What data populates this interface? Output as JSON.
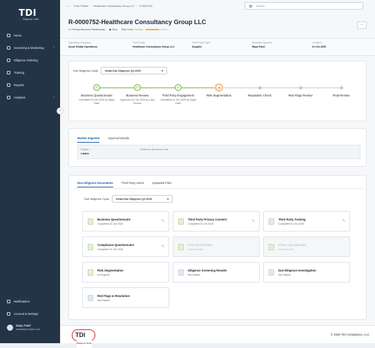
{
  "sidebar": {
    "logo": "TDI",
    "logo_sub": "Diligence Suite",
    "items": [
      {
        "label": "Home",
        "chev": ""
      },
      {
        "label": "Screening & Monitoring",
        "chev": "›"
      },
      {
        "label": "Diligence Ordering",
        "chev": ""
      },
      {
        "label": "Training",
        "chev": ""
      },
      {
        "label": "Reports",
        "chev": ""
      },
      {
        "label": "Analytics",
        "chev": "›"
      }
    ],
    "bottom": [
      {
        "label": "Notifications"
      },
      {
        "label": "Account & Settings"
      }
    ],
    "user_name": "Maya Patel",
    "user_email": "mpatel@example.com",
    "collapse": "‹"
  },
  "breadcrumb": {
    "home": "⌂",
    "sep": "/",
    "b1": "Third Parties",
    "b2": "Healthcare Consultancy Group LLC",
    "b3": "R-0000752"
  },
  "search": {
    "placeholder": "Search..."
  },
  "header": {
    "title": "R-0000752-Healthcare Consultancy Group LLC",
    "tag1": "Primary Business Relationship",
    "tag2": "New",
    "risk_label": "Risk Level:",
    "risk_value": "Medium",
    "risk_fraction": 0.6,
    "more": "···"
  },
  "info": {
    "c1_label": "Operating Company:",
    "c1_value": "Acme Global Operations",
    "c2_label": "Third Party:",
    "c2_value": "Healthcare Consultancy Group LLC",
    "c3_label": "Third Party Type:",
    "c3_value": "Supplier",
    "c4_label": "Business Sponsor:",
    "c4_value": "Maya Patel",
    "c5_label": "Created:",
    "c5_value": "01 Oct 2025"
  },
  "cycle": {
    "label": "Due Diligence Cycle",
    "value": "Initial Due Diligence Q4 2025"
  },
  "steps": [
    {
      "label": "Business Questionnaire",
      "sub": "Submitted 01 Oct 2025 by Maya Patel",
      "status": "done"
    },
    {
      "label": "Business Review",
      "sub": "Approved 01 Oct 2025 by Liam Brooks",
      "status": "done"
    },
    {
      "label": "Third Party Engagement",
      "sub": "Submitted 01 Oct 2025 by Maya Patel",
      "status": "done"
    },
    {
      "label": "Risk Segmentation",
      "sub": "",
      "status": "current"
    },
    {
      "label": "Reputation Check",
      "sub": "",
      "status": "todo"
    },
    {
      "label": "Red Flags Review",
      "sub": "",
      "status": "todo"
    },
    {
      "label": "Final Review",
      "sub": "",
      "status": "todo"
    }
  ],
  "segment": {
    "tab1": "Market Segment",
    "tab2": "Approval Details",
    "region_label": "Region:",
    "region_value": "LatAm",
    "units_label": "Additional Business Units:"
  },
  "docs_tabs": {
    "t1": "Due Diligence Documents",
    "t2": "Third Party Users",
    "t3": "Uploaded Files"
  },
  "doc_cycle": {
    "label": "Due Diligence Cycle",
    "value": "Initial Due Diligence Q4 2025"
  },
  "docs": [
    {
      "title": "Business Questionnaire",
      "status": "Completed 01 Oct 2025",
      "kind": "done",
      "edit": "✎"
    },
    {
      "title": "Third Party Privacy Consent",
      "status": "Completed 01 Oct 2025",
      "kind": "done",
      "edit": "✎"
    },
    {
      "title": "Third Party Training",
      "status": "Completed 01 Oct 2025",
      "kind": "done",
      "edit": "✎"
    },
    {
      "title": "Compliance Questionnaire",
      "status": "Completed 01 Oct 2025",
      "kind": "done",
      "edit": "✎"
    },
    {
      "title": "EHS Questionnaire",
      "status": "Not Applicable",
      "kind": "dis",
      "edit": ""
    },
    {
      "title": "Infosec Questionnaire",
      "status": "Not Applicable",
      "kind": "dis",
      "edit": ""
    },
    {
      "title": "Risk Segmentation",
      "status": "In Progress",
      "kind": "done",
      "edit": ""
    },
    {
      "title": "Diligence Screening Results",
      "status": "Not Started",
      "kind": "ns",
      "edit": ""
    },
    {
      "title": "Due Diligence Investigation",
      "status": "Not Started",
      "kind": "ns",
      "edit": ""
    },
    {
      "title": "Red Flags & Resolution",
      "status": "Not Started",
      "kind": "ns",
      "edit": ""
    }
  ],
  "footer": {
    "logo": "TDI",
    "logo_sub": "Diligence Suite",
    "copyright": "© 2025 TDI Compliance, LLC"
  },
  "colors": {
    "done": "#7bb24e",
    "current": "#e89a3c",
    "todo": "#c7ccd3",
    "brand": "#1b5fa8"
  }
}
